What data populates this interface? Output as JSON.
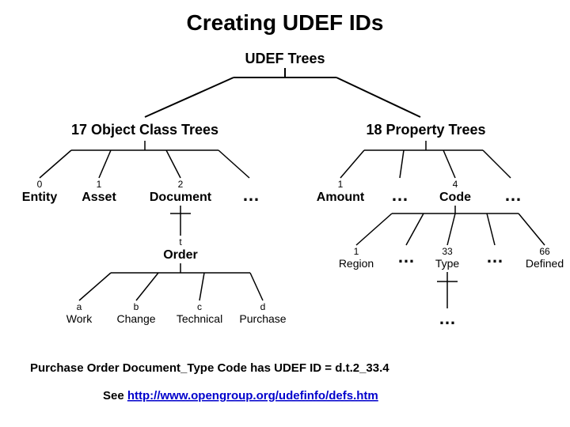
{
  "title": "Creating UDEF IDs",
  "root": "UDEF Trees",
  "left_branch": "17 Object Class Trees",
  "right_branch": "18 Property Trees",
  "objects": {
    "entity": {
      "num": "0",
      "label": "Entity"
    },
    "asset": {
      "num": "1",
      "label": "Asset"
    },
    "document": {
      "num": "2",
      "label": "Document"
    },
    "ellipsis": "…"
  },
  "properties": {
    "amount": {
      "num": "1",
      "label": "Amount"
    },
    "ellipsis1": "…",
    "code": {
      "num": "4",
      "label": "Code"
    },
    "ellipsis2": "…"
  },
  "doc_children": {
    "order": {
      "num": "t",
      "label": "Order"
    }
  },
  "order_children": {
    "work": {
      "num": "a",
      "label": "Work"
    },
    "change": {
      "num": "b",
      "label": "Change"
    },
    "technical": {
      "num": "c",
      "label": "Technical"
    },
    "purchase": {
      "num": "d",
      "label": "Purchase"
    }
  },
  "code_children": {
    "region": {
      "num": "1",
      "label": "Region"
    },
    "ellipsis1": "…",
    "type": {
      "num": "33",
      "label": "Type"
    },
    "ellipsis2": "…",
    "defined": {
      "num": "66",
      "label": "Defined"
    }
  },
  "type_children": {
    "ellipsis": "…"
  },
  "footer_sentence": "Purchase Order Document_Type Code  has UDEF ID = d.t.2_33.4",
  "see_prefix": "See ",
  "see_url": "http://www.opengroup.org/udefinfo/defs.htm"
}
